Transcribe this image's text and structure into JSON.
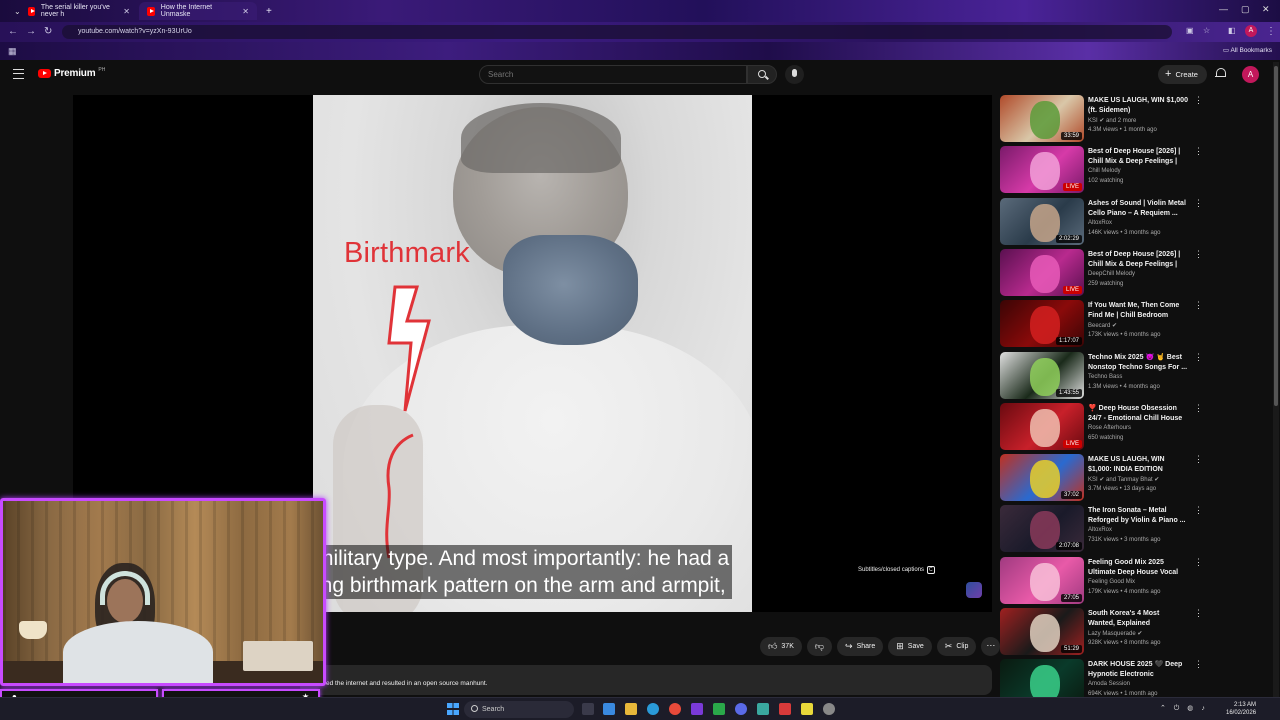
{
  "browser": {
    "tabs": [
      {
        "title": "The serial killer you've never h"
      },
      {
        "title": "How the Internet Unmaske"
      }
    ],
    "url": "youtube.com/watch?v=yzXn-93UrUo",
    "all_bookmarks": "All Bookmarks"
  },
  "youtube": {
    "logo_text": "Premium",
    "logo_sup": "PH",
    "search_placeholder": "Search",
    "create_label": "Create",
    "avatar_letter": "A"
  },
  "player": {
    "annotation": "Birthmark",
    "subtitle_line1": "military type. And most importantly: he had a",
    "subtitle_line2": "ing birthmark pattern on the arm and armpit,",
    "cc_label": "Subtitles/closed captions",
    "cc_key": "C"
  },
  "actions": {
    "likes": "37K",
    "share": "Share",
    "save": "Save",
    "clip": "Clip"
  },
  "description_snippet": "ed the internet and resulted in an open source manhunt.",
  "recommendations": [
    {
      "title": "MAKE US LAUGH, WIN $1,000 (ft. Sidemen)",
      "channel": "KSI ✔ and 2 more",
      "meta": "4.3M views • 1 month ago",
      "badge": "33:59",
      "live": false,
      "colors": [
        "#d9c7a8",
        "#5c9b3a",
        "#b04a2a"
      ]
    },
    {
      "title": "Best of Deep House [2026] | Chill Mix & Deep Feelings | De...",
      "channel": "Chill Melody",
      "meta": "102 watching",
      "badge": "LIVE",
      "live": true,
      "colors": [
        "#d63aa8",
        "#f2a0d8",
        "#7a1a6a"
      ]
    },
    {
      "title": "Ashes of Sound | Violin Metal Cello Piano – A Requiem ...",
      "channel": "AltoxRox",
      "meta": "146K views • 3 months ago",
      "badge": "2:02:29",
      "live": false,
      "colors": [
        "#2a3b4a",
        "#c5a58a",
        "#5a6a7a"
      ]
    },
    {
      "title": "Best of Deep House [2026] | Chill Mix & Deep Feelings | De...",
      "channel": "DeepChill Melody",
      "meta": "259 watching",
      "badge": "LIVE",
      "live": true,
      "colors": [
        "#b82a8e",
        "#e85ab8",
        "#5a1050"
      ]
    },
    {
      "title": "If You Want Me, Then Come Find Me | Chill Bedroom Playli...",
      "channel": "Beecard ✔",
      "meta": "173K views • 6 months ago",
      "badge": "1:17:07",
      "live": false,
      "colors": [
        "#8a0a0a",
        "#d42020",
        "#3a0505"
      ]
    },
    {
      "title": "Techno Mix 2025 😈 🤘 Best Nonstop Techno Songs For ...",
      "channel": "Techno Bass",
      "meta": "1.3M views • 4 months ago",
      "badge": "1:43:55",
      "live": false,
      "colors": [
        "#1a2a1a",
        "#8fd05a",
        "#e0e0e0"
      ]
    },
    {
      "title": "❣️ Deep House Obsession 24/7 - Emotional Chill House Live ...",
      "channel": "Rose Afterhours",
      "meta": "650 watching",
      "badge": "LIVE",
      "live": true,
      "colors": [
        "#c8202a",
        "#f0c0b0",
        "#6a0a10"
      ]
    },
    {
      "title": "MAKE US LAUGH, WIN $1,000: INDIA EDITION",
      "channel": "KSI ✔ and Tanmay Bhat ✔",
      "meta": "3.7M views • 13 days ago",
      "badge": "37:02",
      "live": false,
      "colors": [
        "#2a6ad0",
        "#e8d02a",
        "#c03020"
      ]
    },
    {
      "title": "The Iron Sonata – Metal Reforged by Violin & Piano ...",
      "channel": "AltoxRox",
      "meta": "731K views • 3 months ago",
      "badge": "2:07:08",
      "live": false,
      "colors": [
        "#1a1a2a",
        "#8a3a5a",
        "#3a2a3a"
      ]
    },
    {
      "title": "Feeling Good Mix 2025 Ultimate Deep House Vocal Nu ...",
      "channel": "Feeling Good Mix",
      "meta": "179K views • 4 months ago",
      "badge": "27:05",
      "live": false,
      "colors": [
        "#e85aa8",
        "#f8c0d8",
        "#a03a80"
      ]
    },
    {
      "title": "South Korea's 4 Most Wanted, Explained",
      "channel": "Lazy Masquerade ✔",
      "meta": "928K views • 8 months ago",
      "badge": "51:29",
      "live": false,
      "colors": [
        "#1a1a1a",
        "#e0d0c0",
        "#a02020"
      ]
    },
    {
      "title": "DARK HOUSE 2025 🖤 Deep Hypnotic Electronic Experience",
      "channel": "Amoda Session",
      "meta": "694K views • 1 month ago",
      "badge": "",
      "live": false,
      "colors": [
        "#0a3a2a",
        "#3ad08a",
        "#0a1a10"
      ]
    }
  ],
  "taskbar": {
    "search_label": "Search",
    "time": "2:13 AM",
    "date": "16/02/2026"
  }
}
